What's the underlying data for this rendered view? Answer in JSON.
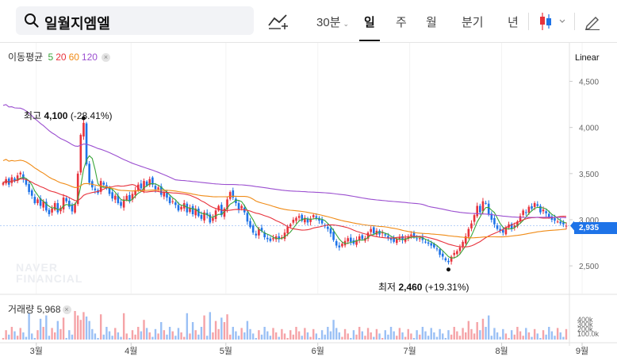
{
  "stock": {
    "name": "일월지엠엘"
  },
  "tabs": [
    {
      "label": "30분",
      "has_dropdown": true
    },
    {
      "label": "일",
      "active": true
    },
    {
      "label": "주"
    },
    {
      "label": "월"
    },
    {
      "label": "분기"
    },
    {
      "label": "년"
    }
  ],
  "icons": {
    "search": "search-icon",
    "indicator": "add-indicator-icon",
    "chart_type": "candlestick-icon",
    "draw": "pencil-icon"
  },
  "ma_legend": {
    "label": "이동평균",
    "periods": [
      {
        "value": "5",
        "color": "#3aa53a"
      },
      {
        "value": "20",
        "color": "#e8323c"
      },
      {
        "value": "60",
        "color": "#f08b16"
      },
      {
        "value": "120",
        "color": "#9b4fd0"
      }
    ]
  },
  "scale_mode": "Linear",
  "y_axis_ticks": [
    "4,500",
    "4,000",
    "3,500",
    "3,000",
    "2,500"
  ],
  "current_price": "2,935",
  "annotations": {
    "high": {
      "prefix": "최고",
      "value": "4,100",
      "change": "(-28.41%)"
    },
    "low": {
      "prefix": "최저",
      "value": "2,460",
      "change": "(+19.31%)"
    }
  },
  "volume": {
    "label": "거래량",
    "value": "5,968",
    "ticks": [
      "400k",
      "300k",
      "200k",
      "100.0k"
    ]
  },
  "x_axis_labels": [
    "3월",
    "4월",
    "5월",
    "6월",
    "7월",
    "8월",
    "9월"
  ],
  "watermark": [
    "NAVER",
    "FINANCIAL"
  ],
  "colors": {
    "up": "#e8323c",
    "down": "#1e73e8",
    "accent": "#1e73e8"
  },
  "chart_data": {
    "type": "candlestick",
    "y_range": [
      2200,
      4900
    ],
    "moving_average_periods": [
      5,
      20,
      60,
      120
    ],
    "closes": [
      3400,
      3440,
      3380,
      3460,
      3420,
      3480,
      3510,
      3440,
      3380,
      3300,
      3260,
      3180,
      3220,
      3150,
      3200,
      3100,
      3060,
      3120,
      3180,
      3080,
      3130,
      3240,
      3200,
      3140,
      3090,
      3170,
      3500,
      3920,
      4050,
      3600,
      3400,
      3350,
      3320,
      3290,
      3420,
      3380,
      3340,
      3280,
      3230,
      3260,
      3180,
      3150,
      3220,
      3260,
      3200,
      3280,
      3320,
      3380,
      3340,
      3420,
      3370,
      3440,
      3380,
      3330,
      3350,
      3270,
      3300,
      3240,
      3180,
      3200,
      3160,
      3100,
      3140,
      3180,
      3080,
      3130,
      3060,
      3120,
      3040,
      3010,
      3080,
      3050,
      2970,
      3020,
      3100,
      3150,
      3050,
      3120,
      3220,
      3300,
      3240,
      3180,
      3110,
      3150,
      3080,
      2980,
      2920,
      2860,
      2830,
      2900,
      2880,
      2810,
      2790,
      2770,
      2800,
      2820,
      2790,
      2810,
      2860,
      2920,
      2950,
      3000,
      3020,
      3040,
      2990,
      3020,
      2970,
      3010,
      3050,
      3020,
      2990,
      2960,
      2930,
      2900,
      2850,
      2780,
      2720,
      2700,
      2740,
      2770,
      2800,
      2760,
      2740,
      2780,
      2820,
      2790,
      2800,
      2860,
      2900,
      2850,
      2880,
      2840,
      2860,
      2830,
      2800,
      2780,
      2760,
      2790,
      2810,
      2780,
      2800,
      2820,
      2840,
      2810,
      2790,
      2800,
      2780,
      2760,
      2740,
      2720,
      2700,
      2680,
      2620,
      2600,
      2560,
      2540,
      2600,
      2640,
      2660,
      2700,
      2760,
      2820,
      2900,
      2960,
      3050,
      3150,
      3080,
      3200,
      3180,
      3060,
      3000,
      2950,
      2900,
      2880,
      2860,
      2920,
      2950,
      2900,
      2940,
      2980,
      3040,
      3100,
      3080,
      3140,
      3120,
      3180,
      3150,
      3080,
      3110,
      3070,
      3030,
      3000,
      2990,
      2980,
      2960,
      2950,
      2935
    ],
    "volume_peak_label": "400k"
  }
}
